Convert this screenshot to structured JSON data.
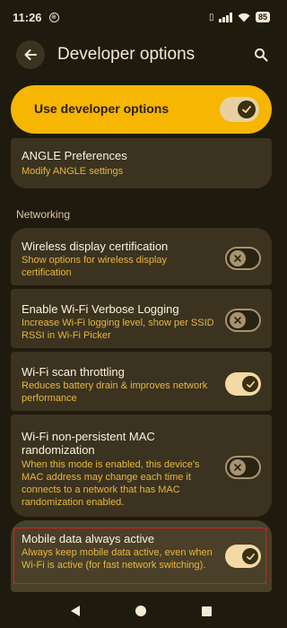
{
  "status_bar": {
    "time": "11:26",
    "battery": "85"
  },
  "app_bar": {
    "title": "Developer options"
  },
  "master_switch": {
    "label": "Use developer options",
    "checked": true
  },
  "angle_card": {
    "title": "ANGLE Preferences",
    "subtitle": "Modify ANGLE settings"
  },
  "section": {
    "header": "Networking"
  },
  "settings": [
    {
      "title": "Wireless display certification",
      "subtitle": "Show options for wireless display certification",
      "checked": false
    },
    {
      "title": "Enable Wi-Fi Verbose Logging",
      "subtitle": "Increase Wi-Fi logging level, show per SSID RSSI in Wi-Fi Picker",
      "checked": false
    },
    {
      "title": "Wi-Fi scan throttling",
      "subtitle": "Reduces battery drain & improves network performance",
      "checked": true
    },
    {
      "title": "Wi-Fi non-persistent MAC randomization",
      "subtitle": "When this mode is enabled, this device’s MAC address may change each time it connects to a network that has MAC randomization enabled.",
      "checked": false
    },
    {
      "title": "Mobile data always active",
      "subtitle": "Always keep mobile data active, even when Wi-Fi is active (for fast network switching).",
      "checked": true
    }
  ],
  "icons": {
    "back": "arrow-left-icon",
    "search": "search-icon",
    "check": "check-icon",
    "close": "close-icon"
  },
  "colors": {
    "background": "#1f1a0e",
    "accent": "#f6b602",
    "card": "#3b331f",
    "subtitle": "#e9b53f",
    "highlight": "#d51f1f"
  }
}
